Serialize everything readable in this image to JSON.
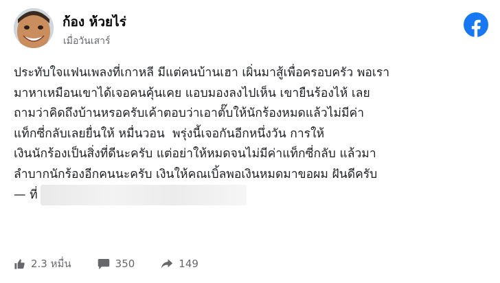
{
  "post": {
    "author": "ก้อง ห้วยไร่",
    "time": "เมื่อวันเสาร์",
    "body_lines": [
      "ประทับใจแฟนเพลงที่เกาหลี มีแต่คนบ้านเฮา เผิ่นมาสู้เพื่อครอบครัว พอเรา",
      "มาหาเหมือนเขาได้เจอคนคุ้นเคย แอบมองลงไปเห็น เขายืนร้องไห้ เลย",
      "ถามว่าคิดถึงบ้านหรอครับเค้าตอบว่าเอาตั๊บให้นักร้องหมดแล้วไม่มีค่า",
      "แท็กซี่กลับเลยยื่นให้ ￼หมื่นวอน ￼ พรุ่งนี้เจอกันอีกหนึ่งวัน￼ การให้",
      "เงินนักร้องเป็นสิ่งที่ดีนะครับ แต่อย่าให้หมดจนไม่มีค่าแท็กซี่กลับ แล้วมา",
      "ลำบากนักร้องอีกคนนะครับ￼ เงินให้คณเบิ้ลพอเงินหมดมาขอผม ฝันดีครับ"
    ],
    "location_prefix": "— ที่"
  },
  "stats": {
    "reactions": "2.3 หมื่น",
    "comments": "350",
    "shares": "149"
  },
  "colors": {
    "facebook_blue": "#1877f2",
    "secondary_text": "#65676b"
  },
  "icons": [
    "avatar-photo",
    "facebook-logo-icon",
    "like-icon",
    "comment-icon",
    "share-icon"
  ]
}
